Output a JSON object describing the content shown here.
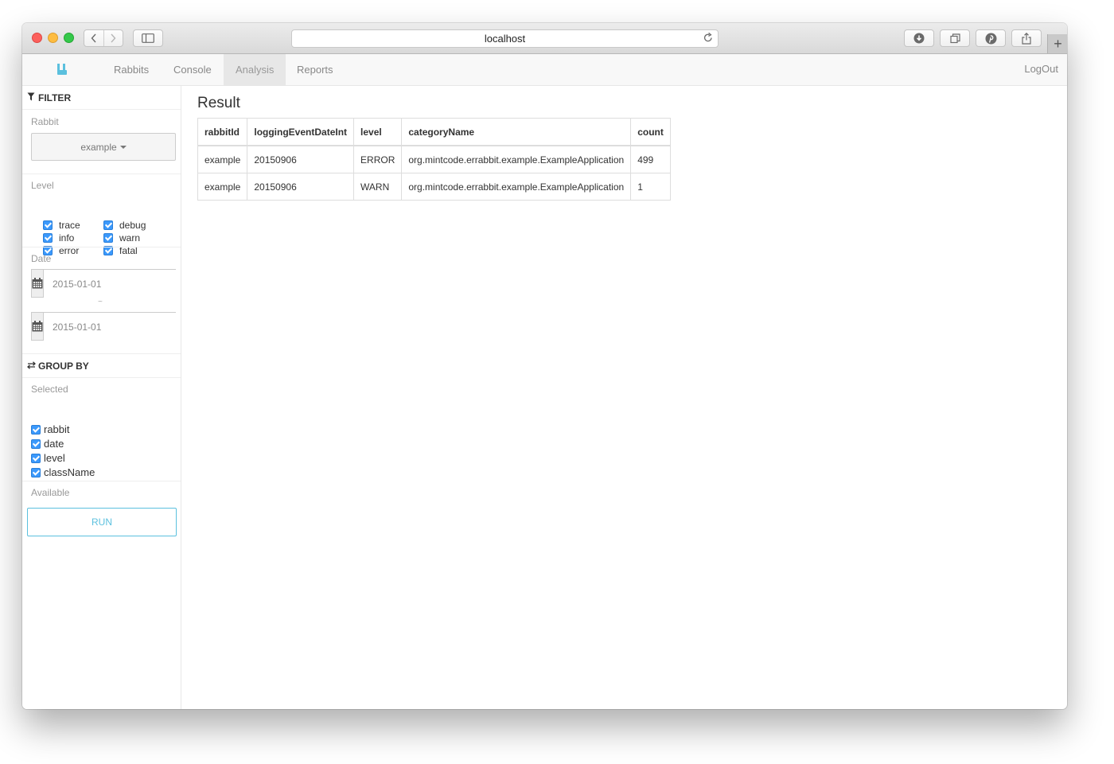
{
  "browser": {
    "url": "localhost",
    "icons": [
      "back-icon",
      "forward-icon",
      "sidebar-icon",
      "reload-icon",
      "download-icon",
      "tabs-icon",
      "pinterest-icon",
      "share-icon",
      "plus-icon"
    ]
  },
  "nav": {
    "items": [
      {
        "label": "Rabbits",
        "active": false
      },
      {
        "label": "Console",
        "active": false
      },
      {
        "label": "Analysis",
        "active": true
      },
      {
        "label": "Reports",
        "active": false
      }
    ],
    "logout": "LogOut",
    "accent": "#5bc0de"
  },
  "filter": {
    "title": "FILTER",
    "rabbit_label": "Rabbit",
    "rabbit_value": "example",
    "level_label": "Level",
    "levels": [
      {
        "label": "trace",
        "checked": true
      },
      {
        "label": "debug",
        "checked": true
      },
      {
        "label": "info",
        "checked": true
      },
      {
        "label": "warn",
        "checked": true
      },
      {
        "label": "error",
        "checked": true
      },
      {
        "label": "fatal",
        "checked": true
      }
    ],
    "date_label": "Date",
    "date_from": "2015-01-01",
    "date_sep": "~",
    "date_to": "2015-01-01"
  },
  "group_by": {
    "title": "GROUP BY",
    "selected_label": "Selected",
    "selected": [
      {
        "label": "rabbit",
        "checked": true
      },
      {
        "label": "date",
        "checked": true
      },
      {
        "label": "level",
        "checked": true
      },
      {
        "label": "className",
        "checked": true
      }
    ],
    "available_label": "Available",
    "run_label": "RUN"
  },
  "result": {
    "title": "Result",
    "columns": [
      "rabbitId",
      "loggingEventDateInt",
      "level",
      "categoryName",
      "count"
    ],
    "rows": [
      [
        "example",
        "20150906",
        "ERROR",
        "org.mintcode.errabbit.example.ExampleApplication",
        "499"
      ],
      [
        "example",
        "20150906",
        "WARN",
        "org.mintcode.errabbit.example.ExampleApplication",
        "1"
      ]
    ]
  }
}
